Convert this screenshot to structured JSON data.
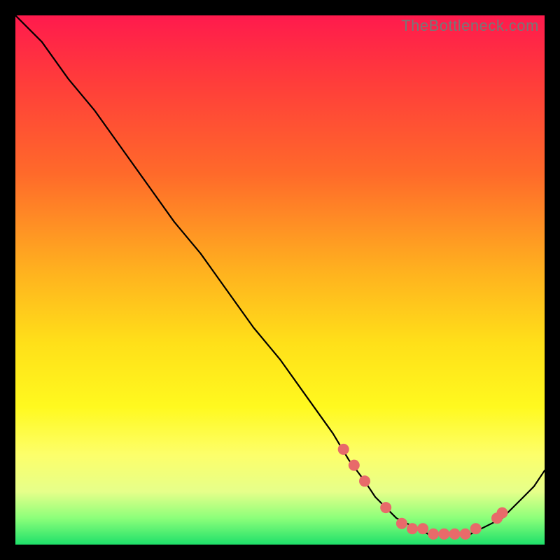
{
  "watermark": "TheBottleneck.com",
  "gradient_colors": {
    "top": "#ff1a4d",
    "upper_mid": "#ff6a2a",
    "mid": "#ffe019",
    "lower_mid": "#fdff6a",
    "bottom": "#1ee06a"
  },
  "chart_data": {
    "type": "line",
    "title": "",
    "xlabel": "",
    "ylabel": "",
    "xlim": [
      0,
      100
    ],
    "ylim": [
      0,
      100
    ],
    "series": [
      {
        "name": "bottleneck-curve",
        "x": [
          0,
          5,
          10,
          15,
          20,
          25,
          30,
          35,
          40,
          45,
          50,
          55,
          60,
          63,
          66,
          68,
          70,
          72,
          74,
          76,
          78,
          80,
          82,
          84,
          86,
          88,
          90,
          92,
          94,
          96,
          98,
          100
        ],
        "y": [
          100,
          95,
          88,
          82,
          75,
          68,
          61,
          55,
          48,
          41,
          35,
          28,
          21,
          16,
          12,
          9,
          7,
          5,
          4,
          3,
          2,
          2,
          2,
          2,
          2,
          3,
          4,
          5,
          7,
          9,
          11,
          14
        ]
      }
    ],
    "markers": {
      "name": "highlight-dots",
      "x": [
        62,
        64,
        66,
        70,
        73,
        75,
        77,
        79,
        81,
        83,
        85,
        87,
        91,
        92
      ],
      "y": [
        18,
        15,
        12,
        7,
        4,
        3,
        3,
        2,
        2,
        2,
        2,
        3,
        5,
        6
      ]
    }
  }
}
